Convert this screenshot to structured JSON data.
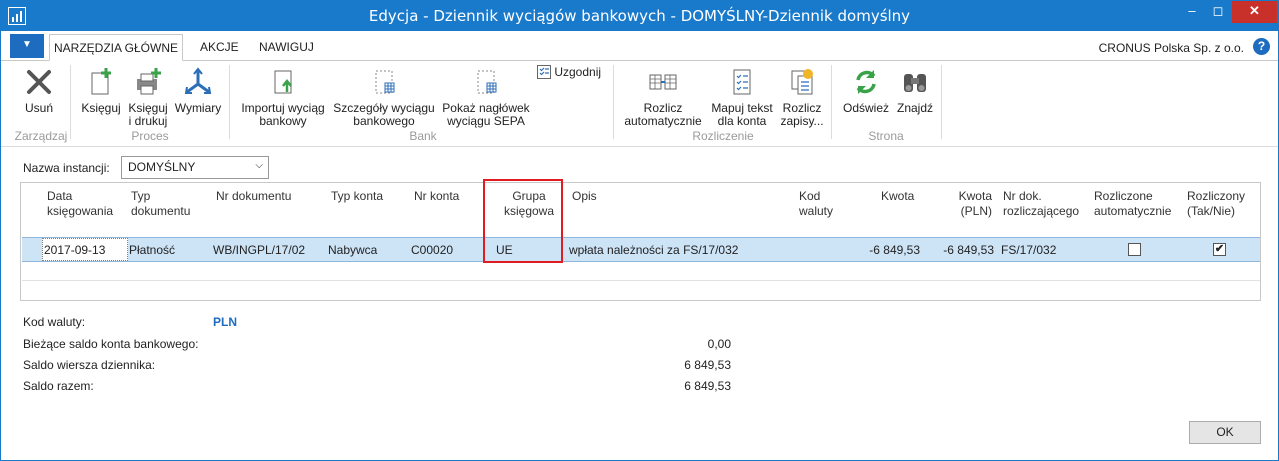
{
  "window": {
    "title": "Edycja - Dziennik wyciągów bankowych - DOMYŚLNY-Dziennik domyślny",
    "min_icon": "minimize-icon",
    "max_icon": "maximize-icon",
    "close_icon": "close-icon",
    "min_glyph": "‒",
    "max_glyph": "◻",
    "close_glyph": "✕"
  },
  "tabs": {
    "home": "NARZĘDZIA GŁÓWNE",
    "actions": "AKCJE",
    "navigate": "NAWIGUJ",
    "menu_glyph": "▼"
  },
  "company": "CRONUS Polska Sp. z o.o.",
  "help_glyph": "?",
  "ribbon": {
    "delete": "Usuń",
    "post": "Księguj",
    "post_print_1": "Księguj",
    "post_print_2": "i drukuj",
    "dimensions": "Wymiary",
    "import_1": "Importuj wyciąg",
    "import_2": "bankowy",
    "details_1": "Szczegóły wyciągu",
    "details_2": "bankowego",
    "sepa_1": "Pokaż nagłówek",
    "sepa_2": "wyciągu SEPA",
    "reconcile": "Uzgodnij",
    "auto_1": "Rozlicz",
    "auto_2": "automatycznie",
    "map_1": "Mapuj tekst",
    "map_2": "dla konta",
    "apply_1": "Rozlicz",
    "apply_2": "zapisy...",
    "refresh": "Odśwież",
    "find": "Znajdź",
    "groups": {
      "manage": "Zarządzaj",
      "process": "Proces",
      "bank": "Bank",
      "reconciliation": "Rozliczenie",
      "page": "Strona"
    }
  },
  "instance": {
    "label": "Nazwa instancji:",
    "value": "DOMYŚLNY",
    "chevron": "⌵"
  },
  "columns": {
    "date_1": "Data",
    "date_2": "księgowania",
    "type_1": "Typ",
    "type_2": "dokumentu",
    "docno": "Nr dokumentu",
    "acctype": "Typ konta",
    "accno": "Nr konta",
    "group_1": "Grupa",
    "group_2": "księgowa",
    "desc": "Opis",
    "cur_1": "Kod",
    "cur_2": "waluty",
    "amount": "Kwota",
    "amountlcy_1": "Kwota",
    "amountlcy_2": "(PLN)",
    "applies_1": "Nr dok.",
    "applies_2": "rozliczającego",
    "autoapplied_1": "Rozliczone",
    "autoapplied_2": "automatycznie",
    "applied_1": "Rozliczony",
    "applied_2": "(Tak/Nie)"
  },
  "row": {
    "date": "2017-09-13",
    "type": "Płatność",
    "docno": "WB/INGPL/17/02",
    "acctype": "Nabywca",
    "accno": "C00020",
    "group": "UE",
    "desc": "wpłata należności za  FS/17/032",
    "amount": "-6 849,53",
    "amountlcy": "-6 849,53",
    "applies": "FS/17/032",
    "autoapplied": false,
    "applied": true,
    "check_glyph": "✔"
  },
  "footer": {
    "currency_label": "Kod waluty:",
    "currency_value": "PLN",
    "balance_label": "Bieżące saldo konta bankowego:",
    "balance_value": "0,00",
    "line_label": "Saldo wiersza dziennika:",
    "line_value": "6 849,53",
    "total_label": "Saldo razem:",
    "total_value": "6 849,53"
  },
  "ok_button": "OK",
  "colors": {
    "titlebar": "#1979ca",
    "highlight": "#e11b22",
    "accent": "#1e6cc0",
    "row_selected": "#cde3f6"
  }
}
